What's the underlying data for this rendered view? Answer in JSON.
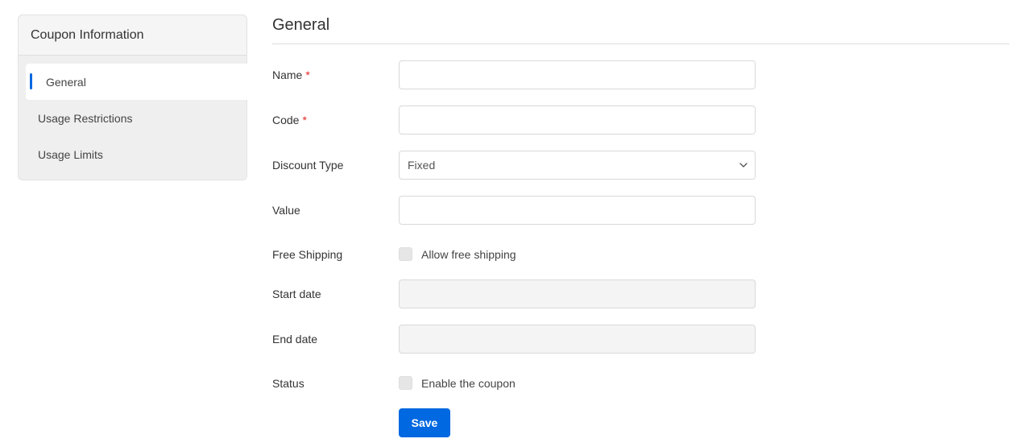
{
  "sidebar": {
    "title": "Coupon Information",
    "items": [
      {
        "label": "General",
        "active": true
      },
      {
        "label": "Usage Restrictions",
        "active": false
      },
      {
        "label": "Usage Limits",
        "active": false
      }
    ]
  },
  "main": {
    "title": "General",
    "fields": {
      "name": {
        "label": "Name",
        "required_mark": "*",
        "value": ""
      },
      "code": {
        "label": "Code",
        "required_mark": "*",
        "value": ""
      },
      "discount_type": {
        "label": "Discount Type",
        "selected": "Fixed"
      },
      "value": {
        "label": "Value",
        "value": ""
      },
      "free_shipping": {
        "label": "Free Shipping",
        "checkbox_label": "Allow free shipping",
        "checked": false
      },
      "start_date": {
        "label": "Start date",
        "value": ""
      },
      "end_date": {
        "label": "End date",
        "value": ""
      },
      "status": {
        "label": "Status",
        "checkbox_label": "Enable the coupon",
        "checked": false
      }
    },
    "save_label": "Save"
  },
  "colors": {
    "accent": "#0068e1",
    "required": "#e22626",
    "sidebar_bg": "#efefef"
  },
  "icons": {
    "select_arrow": "chevron-down-icon"
  }
}
